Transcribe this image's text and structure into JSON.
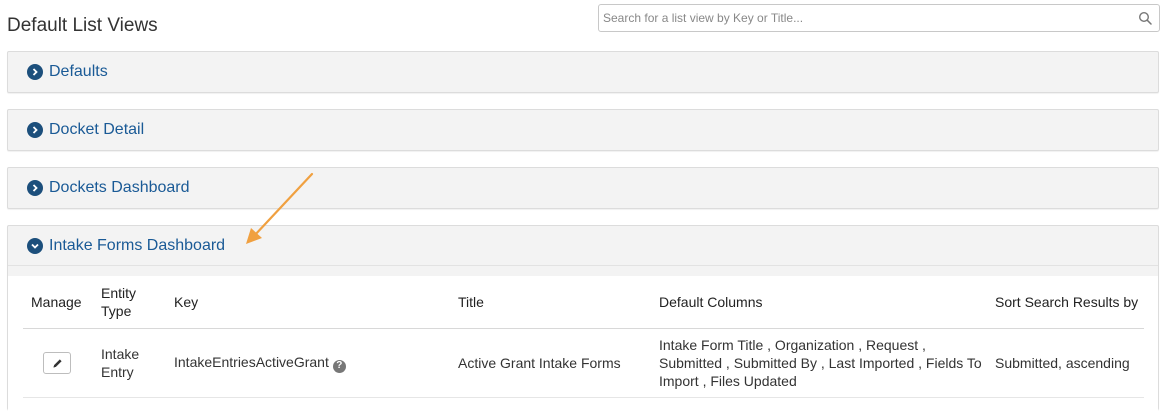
{
  "page": {
    "title": "Default List Views"
  },
  "search": {
    "placeholder": "Search for a list view by Key or Title...",
    "value": ""
  },
  "panels": [
    {
      "label": "Defaults",
      "expanded": false
    },
    {
      "label": "Docket Detail",
      "expanded": false
    },
    {
      "label": "Dockets Dashboard",
      "expanded": false
    },
    {
      "label": "Intake Forms Dashboard",
      "expanded": true
    }
  ],
  "table": {
    "headers": {
      "manage": "Manage",
      "entity_type": "Entity Type",
      "key": "Key",
      "title": "Title",
      "default_columns": "Default Columns",
      "sort": "Sort Search Results by"
    },
    "rows": [
      {
        "entity_type": "Intake Entry",
        "key": "IntakeEntriesActiveGrant",
        "title": "Active Grant Intake Forms",
        "default_columns": "Intake Form Title , Organization , Request , Submitted , Submitted By , Last Imported , Fields To Import , Files Updated",
        "sort": "Submitted, ascending"
      }
    ]
  },
  "colors": {
    "accent": "#1a5a96",
    "chevron": "#1c4f7c",
    "annotation_arrow": "#f0a040"
  },
  "icons": {
    "search": "search-icon",
    "chevron_right": "chevron-right-icon",
    "chevron_down": "chevron-down-icon",
    "edit": "pencil-icon",
    "help": "question-circle-icon"
  }
}
